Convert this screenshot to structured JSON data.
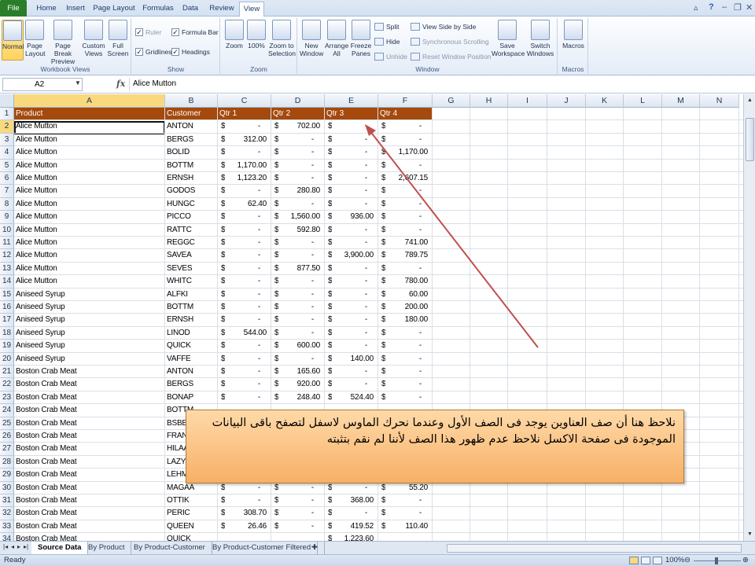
{
  "ribbon_tabs": [
    "File",
    "Home",
    "Insert",
    "Page Layout",
    "Formulas",
    "Data",
    "Review",
    "View"
  ],
  "ribbon": {
    "workbook_views": {
      "label": "Workbook Views",
      "buttons": [
        "Normal",
        "Page Layout",
        "Page Break Preview",
        "Custom Views",
        "Full Screen"
      ]
    },
    "show": {
      "label": "Show",
      "ruler": "Ruler",
      "formula_bar": "Formula Bar",
      "gridlines": "Gridlines",
      "headings": "Headings"
    },
    "zoom": {
      "label": "Zoom",
      "buttons": [
        "Zoom",
        "100%",
        "Zoom to Selection"
      ]
    },
    "window": {
      "label": "Window",
      "buttons": [
        "New Window",
        "Arrange All",
        "Freeze Panes"
      ],
      "split": "Split",
      "hide": "Hide",
      "unhide": "Unhide",
      "view_side_by_side": "View Side by Side",
      "sync_scrolling": "Synchronous Scrolling",
      "reset_position": "Reset Window Position",
      "save_workspace": "Save Workspace",
      "switch_windows": "Switch Windows"
    },
    "macros": {
      "label": "Macros",
      "button": "Macros"
    }
  },
  "formula_bar": {
    "name_box": "A2",
    "fx": "fx",
    "value": "Alice Mutton"
  },
  "columns": [
    "A",
    "B",
    "C",
    "D",
    "E",
    "F",
    "G",
    "H",
    "I",
    "J",
    "K",
    "L",
    "M",
    "N"
  ],
  "headers": [
    "Product",
    "Customer",
    "Qtr 1",
    "Qtr 2",
    "Qtr 3",
    "Qtr 4"
  ],
  "rows": [
    [
      "Alice Mutton",
      "ANTON",
      "-",
      "702.00",
      "-",
      "-"
    ],
    [
      "Alice Mutton",
      "BERGS",
      "312.00",
      "-",
      "-",
      "-"
    ],
    [
      "Alice Mutton",
      "BOLID",
      "-",
      "-",
      "-",
      "1,170.00"
    ],
    [
      "Alice Mutton",
      "BOTTM",
      "1,170.00",
      "-",
      "-",
      "-"
    ],
    [
      "Alice Mutton",
      "ERNSH",
      "1,123.20",
      "-",
      "-",
      "2,607.15"
    ],
    [
      "Alice Mutton",
      "GODOS",
      "-",
      "280.80",
      "-",
      "-"
    ],
    [
      "Alice Mutton",
      "HUNGC",
      "62.40",
      "-",
      "-",
      "-"
    ],
    [
      "Alice Mutton",
      "PICCO",
      "-",
      "1,560.00",
      "936.00",
      "-"
    ],
    [
      "Alice Mutton",
      "RATTC",
      "-",
      "592.80",
      "-",
      "-"
    ],
    [
      "Alice Mutton",
      "REGGC",
      "-",
      "-",
      "-",
      "741.00"
    ],
    [
      "Alice Mutton",
      "SAVEA",
      "-",
      "-",
      "3,900.00",
      "789.75"
    ],
    [
      "Alice Mutton",
      "SEVES",
      "-",
      "877.50",
      "-",
      "-"
    ],
    [
      "Alice Mutton",
      "WHITC",
      "-",
      "-",
      "-",
      "780.00"
    ],
    [
      "Aniseed Syrup",
      "ALFKI",
      "-",
      "-",
      "-",
      "60.00"
    ],
    [
      "Aniseed Syrup",
      "BOTTM",
      "-",
      "-",
      "-",
      "200.00"
    ],
    [
      "Aniseed Syrup",
      "ERNSH",
      "-",
      "-",
      "-",
      "180.00"
    ],
    [
      "Aniseed Syrup",
      "LINOD",
      "544.00",
      "-",
      "-",
      "-"
    ],
    [
      "Aniseed Syrup",
      "QUICK",
      "-",
      "600.00",
      "-",
      "-"
    ],
    [
      "Aniseed Syrup",
      "VAFFE",
      "-",
      "-",
      "140.00",
      "-"
    ],
    [
      "Boston Crab Meat",
      "ANTON",
      "-",
      "165.60",
      "-",
      "-"
    ],
    [
      "Boston Crab Meat",
      "BERGS",
      "-",
      "920.00",
      "-",
      "-"
    ],
    [
      "Boston Crab Meat",
      "BONAP",
      "-",
      "248.40",
      "524.40",
      "-"
    ],
    [
      "Boston Crab Meat",
      "BOTTM",
      "",
      "",
      "",
      ""
    ],
    [
      "Boston Crab Meat",
      "BSBEV",
      "",
      "",
      "",
      ""
    ],
    [
      "Boston Crab Meat",
      "FRANK",
      "",
      "",
      "",
      ""
    ],
    [
      "Boston Crab Meat",
      "HILAA",
      "",
      "",
      "",
      ""
    ],
    [
      "Boston Crab Meat",
      "LAZYK",
      "",
      "",
      "",
      ""
    ],
    [
      "Boston Crab Meat",
      "LEHMS",
      "",
      "",
      "",
      ""
    ],
    [
      "Boston Crab Meat",
      "MAGAA",
      "-",
      "-",
      "-",
      "55.20"
    ],
    [
      "Boston Crab Meat",
      "OTTIK",
      "-",
      "-",
      "368.00",
      "-"
    ],
    [
      "Boston Crab Meat",
      "PERIC",
      "308.70",
      "-",
      "-",
      "-"
    ],
    [
      "Boston Crab Meat",
      "QUEEN",
      "26.46",
      "-",
      "419.52",
      "110.40"
    ],
    [
      "Boston Crab Meat",
      "QUICK",
      "",
      "",
      "1,223.60",
      ""
    ]
  ],
  "currency_symbol": "$",
  "sheet_tabs": [
    "Source Data",
    "By Product",
    "By Product-Customer",
    "By Product-Customer Filtered"
  ],
  "status": {
    "ready": "Ready",
    "zoom": "100%"
  },
  "callout": {
    "text": "نلاحظ هنا أن صف العناوين يوجد فى الصف الأول وعندما نحرك الماوس لاسفل لتصفح باقى البيانات الموجودة فى صفحة الاكسل نلاحظ عدم ظهور هذا الصف لأننا لم نقم بتثبته"
  },
  "colors": {
    "header_fill": "#a5490d",
    "callout_fill": "#f7b066",
    "arrow": "#c0504d",
    "file_tab": "#2a7d2a"
  }
}
